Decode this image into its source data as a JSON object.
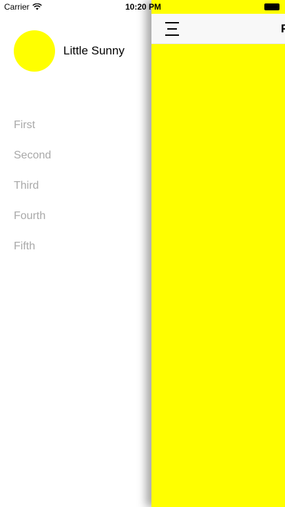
{
  "status_bar": {
    "carrier": "Carrier",
    "wifi_icon": "wifi-icon",
    "time": "10:20 PM",
    "battery_icon": "battery-icon"
  },
  "drawer": {
    "profile": {
      "name": "Little Sunny",
      "avatar_color": "#ffff00"
    },
    "items": [
      {
        "label": "First"
      },
      {
        "label": "Second"
      },
      {
        "label": "Third"
      },
      {
        "label": "Fourth"
      },
      {
        "label": "Fifth"
      }
    ]
  },
  "main": {
    "nav": {
      "menu_icon": "hamburger-icon",
      "title": "F"
    },
    "background_color": "#ffff00"
  }
}
